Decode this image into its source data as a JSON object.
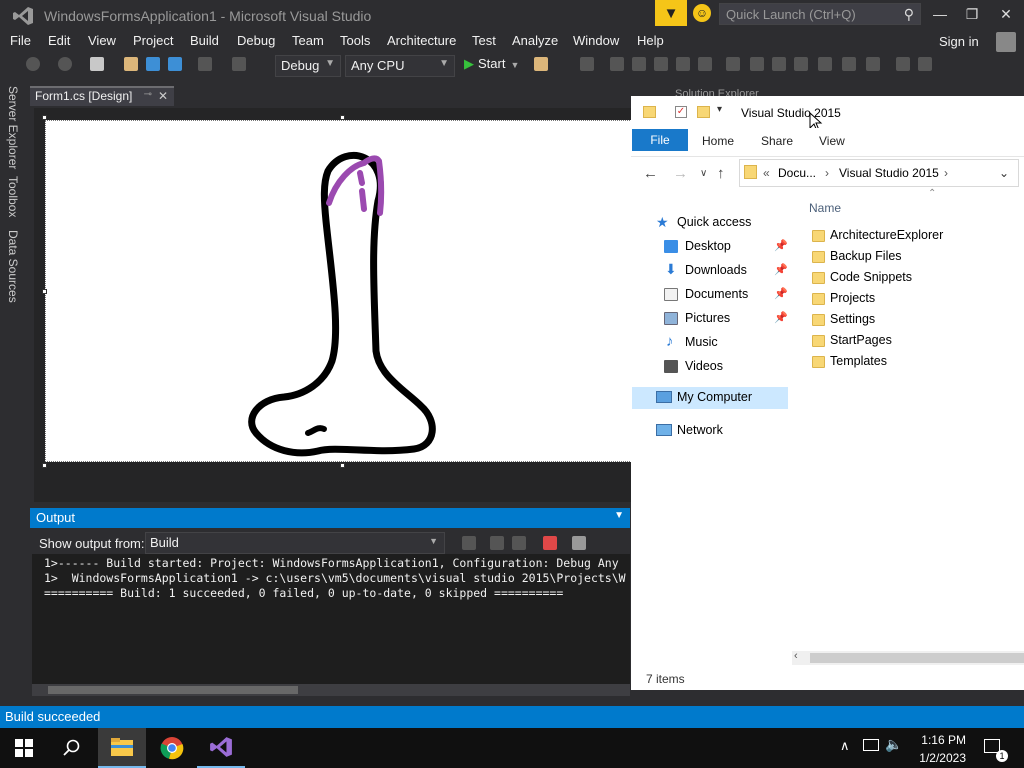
{
  "vs": {
    "window_title": "WindowsFormsApplication1 - Microsoft Visual Studio",
    "quick_launch_placeholder": "Quick Launch (Ctrl+Q)",
    "menu": [
      "File",
      "Edit",
      "View",
      "Project",
      "Build",
      "Debug",
      "Team",
      "Tools",
      "Architecture",
      "Test",
      "Analyze",
      "Window",
      "Help"
    ],
    "sign_in": "Sign in",
    "config_dropdown": "Debug",
    "platform_dropdown": "Any CPU",
    "start_label": "Start",
    "side_tabs": [
      "Server Explorer",
      "Toolbox",
      "Data Sources"
    ],
    "doc_tab": "Form1.cs [Design]",
    "solution_explorer_label": "Solution Explorer",
    "output": {
      "title": "Output",
      "show_from_label": "Show output from:",
      "source": "Build",
      "lines": [
        "1>------ Build started: Project: WindowsFormsApplication1, Configuration: Debug Any",
        "1>  WindowsFormsApplication1 -> c:\\users\\vm5\\documents\\visual studio 2015\\Projects\\W",
        "========== Build: 1 succeeded, 0 failed, 0 up-to-date, 0 skipped =========="
      ]
    },
    "status": "Build succeeded",
    "colors": {
      "accent": "#007acc",
      "background": "#2d2d30",
      "start_green": "#37c13c"
    }
  },
  "explorer": {
    "title": "Visual Studio 2015",
    "ribbon_tabs": [
      "File",
      "Home",
      "Share",
      "View"
    ],
    "breadcrumb": [
      "Docu...",
      "Visual Studio 2015"
    ],
    "column_header": "Name",
    "nav": [
      {
        "label": "Quick access",
        "icon": "star-icon",
        "pinned": false
      },
      {
        "label": "Desktop",
        "icon": "desktop-icon",
        "pinned": true
      },
      {
        "label": "Downloads",
        "icon": "download-icon",
        "pinned": true
      },
      {
        "label": "Documents",
        "icon": "documents-icon",
        "pinned": true
      },
      {
        "label": "Pictures",
        "icon": "pictures-icon",
        "pinned": true
      },
      {
        "label": "Music",
        "icon": "music-icon",
        "pinned": false
      },
      {
        "label": "Videos",
        "icon": "videos-icon",
        "pinned": false
      },
      {
        "label": "My Computer",
        "icon": "computer-icon",
        "pinned": false,
        "selected": true
      },
      {
        "label": "Network",
        "icon": "network-icon",
        "pinned": false
      }
    ],
    "files": [
      "ArchitectureExplorer",
      "Backup Files",
      "Code Snippets",
      "Projects",
      "Settings",
      "StartPages",
      "Templates"
    ],
    "item_count": "7 items"
  },
  "taskbar": {
    "time": "1:16 PM",
    "date": "1/2/2023",
    "apps": [
      "start-icon",
      "search-icon",
      "file-explorer-icon",
      "chrome-icon",
      "visual-studio-icon"
    ]
  }
}
